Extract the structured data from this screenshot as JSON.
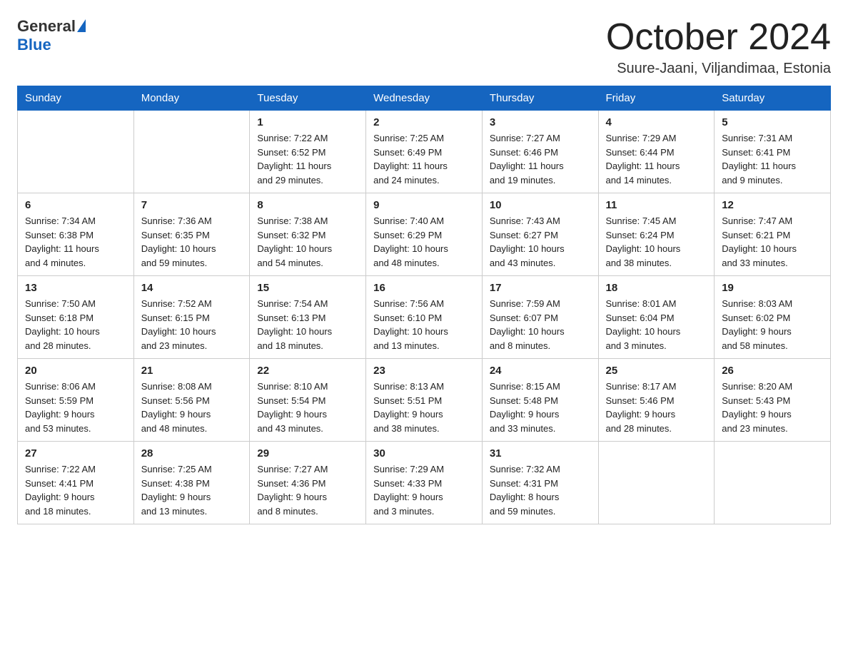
{
  "logo": {
    "text_general": "General",
    "text_blue": "Blue",
    "triangle_alt": "logo triangle"
  },
  "header": {
    "month_title": "October 2024",
    "location": "Suure-Jaani, Viljandimaa, Estonia"
  },
  "days_of_week": [
    "Sunday",
    "Monday",
    "Tuesday",
    "Wednesday",
    "Thursday",
    "Friday",
    "Saturday"
  ],
  "weeks": [
    [
      {
        "num": "",
        "info": ""
      },
      {
        "num": "",
        "info": ""
      },
      {
        "num": "1",
        "info": "Sunrise: 7:22 AM\nSunset: 6:52 PM\nDaylight: 11 hours\nand 29 minutes."
      },
      {
        "num": "2",
        "info": "Sunrise: 7:25 AM\nSunset: 6:49 PM\nDaylight: 11 hours\nand 24 minutes."
      },
      {
        "num": "3",
        "info": "Sunrise: 7:27 AM\nSunset: 6:46 PM\nDaylight: 11 hours\nand 19 minutes."
      },
      {
        "num": "4",
        "info": "Sunrise: 7:29 AM\nSunset: 6:44 PM\nDaylight: 11 hours\nand 14 minutes."
      },
      {
        "num": "5",
        "info": "Sunrise: 7:31 AM\nSunset: 6:41 PM\nDaylight: 11 hours\nand 9 minutes."
      }
    ],
    [
      {
        "num": "6",
        "info": "Sunrise: 7:34 AM\nSunset: 6:38 PM\nDaylight: 11 hours\nand 4 minutes."
      },
      {
        "num": "7",
        "info": "Sunrise: 7:36 AM\nSunset: 6:35 PM\nDaylight: 10 hours\nand 59 minutes."
      },
      {
        "num": "8",
        "info": "Sunrise: 7:38 AM\nSunset: 6:32 PM\nDaylight: 10 hours\nand 54 minutes."
      },
      {
        "num": "9",
        "info": "Sunrise: 7:40 AM\nSunset: 6:29 PM\nDaylight: 10 hours\nand 48 minutes."
      },
      {
        "num": "10",
        "info": "Sunrise: 7:43 AM\nSunset: 6:27 PM\nDaylight: 10 hours\nand 43 minutes."
      },
      {
        "num": "11",
        "info": "Sunrise: 7:45 AM\nSunset: 6:24 PM\nDaylight: 10 hours\nand 38 minutes."
      },
      {
        "num": "12",
        "info": "Sunrise: 7:47 AM\nSunset: 6:21 PM\nDaylight: 10 hours\nand 33 minutes."
      }
    ],
    [
      {
        "num": "13",
        "info": "Sunrise: 7:50 AM\nSunset: 6:18 PM\nDaylight: 10 hours\nand 28 minutes."
      },
      {
        "num": "14",
        "info": "Sunrise: 7:52 AM\nSunset: 6:15 PM\nDaylight: 10 hours\nand 23 minutes."
      },
      {
        "num": "15",
        "info": "Sunrise: 7:54 AM\nSunset: 6:13 PM\nDaylight: 10 hours\nand 18 minutes."
      },
      {
        "num": "16",
        "info": "Sunrise: 7:56 AM\nSunset: 6:10 PM\nDaylight: 10 hours\nand 13 minutes."
      },
      {
        "num": "17",
        "info": "Sunrise: 7:59 AM\nSunset: 6:07 PM\nDaylight: 10 hours\nand 8 minutes."
      },
      {
        "num": "18",
        "info": "Sunrise: 8:01 AM\nSunset: 6:04 PM\nDaylight: 10 hours\nand 3 minutes."
      },
      {
        "num": "19",
        "info": "Sunrise: 8:03 AM\nSunset: 6:02 PM\nDaylight: 9 hours\nand 58 minutes."
      }
    ],
    [
      {
        "num": "20",
        "info": "Sunrise: 8:06 AM\nSunset: 5:59 PM\nDaylight: 9 hours\nand 53 minutes."
      },
      {
        "num": "21",
        "info": "Sunrise: 8:08 AM\nSunset: 5:56 PM\nDaylight: 9 hours\nand 48 minutes."
      },
      {
        "num": "22",
        "info": "Sunrise: 8:10 AM\nSunset: 5:54 PM\nDaylight: 9 hours\nand 43 minutes."
      },
      {
        "num": "23",
        "info": "Sunrise: 8:13 AM\nSunset: 5:51 PM\nDaylight: 9 hours\nand 38 minutes."
      },
      {
        "num": "24",
        "info": "Sunrise: 8:15 AM\nSunset: 5:48 PM\nDaylight: 9 hours\nand 33 minutes."
      },
      {
        "num": "25",
        "info": "Sunrise: 8:17 AM\nSunset: 5:46 PM\nDaylight: 9 hours\nand 28 minutes."
      },
      {
        "num": "26",
        "info": "Sunrise: 8:20 AM\nSunset: 5:43 PM\nDaylight: 9 hours\nand 23 minutes."
      }
    ],
    [
      {
        "num": "27",
        "info": "Sunrise: 7:22 AM\nSunset: 4:41 PM\nDaylight: 9 hours\nand 18 minutes."
      },
      {
        "num": "28",
        "info": "Sunrise: 7:25 AM\nSunset: 4:38 PM\nDaylight: 9 hours\nand 13 minutes."
      },
      {
        "num": "29",
        "info": "Sunrise: 7:27 AM\nSunset: 4:36 PM\nDaylight: 9 hours\nand 8 minutes."
      },
      {
        "num": "30",
        "info": "Sunrise: 7:29 AM\nSunset: 4:33 PM\nDaylight: 9 hours\nand 3 minutes."
      },
      {
        "num": "31",
        "info": "Sunrise: 7:32 AM\nSunset: 4:31 PM\nDaylight: 8 hours\nand 59 minutes."
      },
      {
        "num": "",
        "info": ""
      },
      {
        "num": "",
        "info": ""
      }
    ]
  ]
}
